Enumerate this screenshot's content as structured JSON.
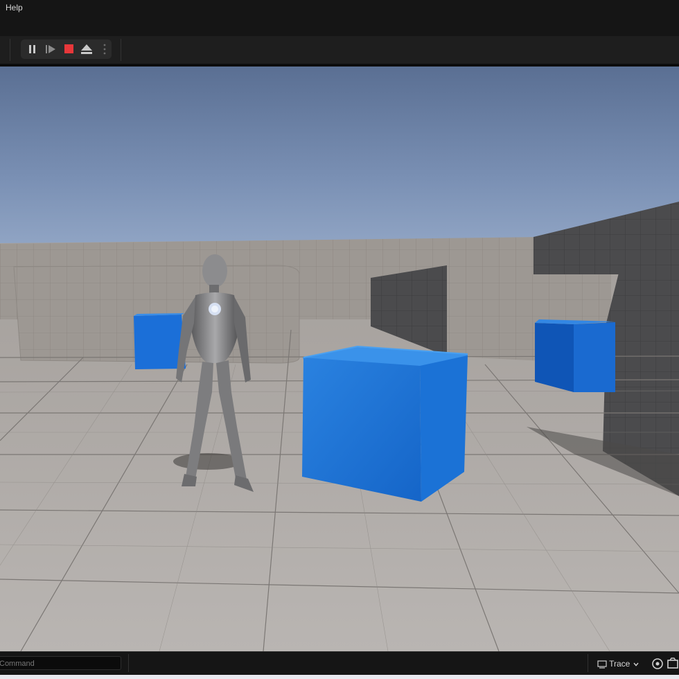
{
  "menubar": {
    "items": [
      "Help"
    ]
  },
  "toolbar": {
    "play_controls": [
      {
        "name": "pause",
        "icon": "pause-icon"
      },
      {
        "name": "frame-skip",
        "icon": "frame-advance-icon"
      },
      {
        "name": "stop",
        "icon": "stop-icon",
        "color": "#e8373a"
      },
      {
        "name": "eject",
        "icon": "eject-icon"
      },
      {
        "name": "more",
        "icon": "more-vertical-icon"
      }
    ]
  },
  "viewport": {
    "sky_color": "#6f86ab",
    "floor_color": "#b2aeab",
    "cube_color": "#1e6fd0"
  },
  "status": {
    "command_placeholder": "Command",
    "trace_label": "Trace"
  }
}
